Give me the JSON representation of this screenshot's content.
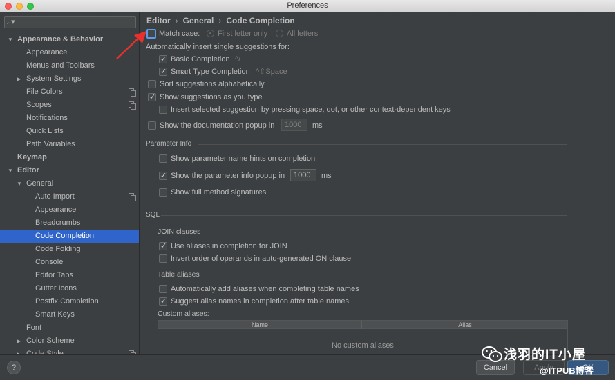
{
  "window": {
    "title": "Preferences"
  },
  "search": {
    "placeholder": ""
  },
  "sidebar": {
    "items": [
      {
        "label": "Appearance & Behavior",
        "level": 0,
        "arrow": "expanded",
        "bold": true,
        "selected": false,
        "settings_icon": false
      },
      {
        "label": "Appearance",
        "level": 1,
        "arrow": "none",
        "bold": false,
        "selected": false,
        "settings_icon": false
      },
      {
        "label": "Menus and Toolbars",
        "level": 1,
        "arrow": "none",
        "bold": false,
        "selected": false,
        "settings_icon": false
      },
      {
        "label": "System Settings",
        "level": 1,
        "arrow": "collapsed",
        "bold": false,
        "selected": false,
        "settings_icon": false
      },
      {
        "label": "File Colors",
        "level": 1,
        "arrow": "none",
        "bold": false,
        "selected": false,
        "settings_icon": true
      },
      {
        "label": "Scopes",
        "level": 1,
        "arrow": "none",
        "bold": false,
        "selected": false,
        "settings_icon": true
      },
      {
        "label": "Notifications",
        "level": 1,
        "arrow": "none",
        "bold": false,
        "selected": false,
        "settings_icon": false
      },
      {
        "label": "Quick Lists",
        "level": 1,
        "arrow": "none",
        "bold": false,
        "selected": false,
        "settings_icon": false
      },
      {
        "label": "Path Variables",
        "level": 1,
        "arrow": "none",
        "bold": false,
        "selected": false,
        "settings_icon": false
      },
      {
        "label": "Keymap",
        "level": 0,
        "arrow": "none",
        "bold": true,
        "selected": false,
        "settings_icon": false
      },
      {
        "label": "Editor",
        "level": 0,
        "arrow": "expanded",
        "bold": true,
        "selected": false,
        "settings_icon": false
      },
      {
        "label": "General",
        "level": 1,
        "arrow": "expanded",
        "bold": false,
        "selected": false,
        "settings_icon": false
      },
      {
        "label": "Auto Import",
        "level": 2,
        "arrow": "none",
        "bold": false,
        "selected": false,
        "settings_icon": true
      },
      {
        "label": "Appearance",
        "level": 2,
        "arrow": "none",
        "bold": false,
        "selected": false,
        "settings_icon": false
      },
      {
        "label": "Breadcrumbs",
        "level": 2,
        "arrow": "none",
        "bold": false,
        "selected": false,
        "settings_icon": false
      },
      {
        "label": "Code Completion",
        "level": 2,
        "arrow": "none",
        "bold": false,
        "selected": true,
        "settings_icon": false
      },
      {
        "label": "Code Folding",
        "level": 2,
        "arrow": "none",
        "bold": false,
        "selected": false,
        "settings_icon": false
      },
      {
        "label": "Console",
        "level": 2,
        "arrow": "none",
        "bold": false,
        "selected": false,
        "settings_icon": false
      },
      {
        "label": "Editor Tabs",
        "level": 2,
        "arrow": "none",
        "bold": false,
        "selected": false,
        "settings_icon": false
      },
      {
        "label": "Gutter Icons",
        "level": 2,
        "arrow": "none",
        "bold": false,
        "selected": false,
        "settings_icon": false
      },
      {
        "label": "Postfix Completion",
        "level": 2,
        "arrow": "none",
        "bold": false,
        "selected": false,
        "settings_icon": false
      },
      {
        "label": "Smart Keys",
        "level": 2,
        "arrow": "none",
        "bold": false,
        "selected": false,
        "settings_icon": false
      },
      {
        "label": "Font",
        "level": 1,
        "arrow": "none",
        "bold": false,
        "selected": false,
        "settings_icon": false
      },
      {
        "label": "Color Scheme",
        "level": 1,
        "arrow": "collapsed",
        "bold": false,
        "selected": false,
        "settings_icon": false
      },
      {
        "label": "Code Style",
        "level": 1,
        "arrow": "collapsed",
        "bold": false,
        "selected": false,
        "settings_icon": true
      }
    ]
  },
  "breadcrumb": {
    "items": [
      "Editor",
      "General",
      "Code Completion"
    ],
    "separator": "›"
  },
  "completion": {
    "match_case": {
      "label": "Match case:",
      "checked": false,
      "options": [
        "First letter only",
        "All letters"
      ],
      "selected_option": "First letter only"
    },
    "auto_insert_heading": "Automatically insert single suggestions for:",
    "basic": {
      "label": "Basic Completion",
      "shortcut": "^/",
      "checked": true
    },
    "smart": {
      "label": "Smart Type Completion",
      "shortcut": "^⇧Space",
      "checked": true
    },
    "sort_alpha": {
      "label": "Sort suggestions alphabetically",
      "checked": false
    },
    "show_as_type": {
      "label": "Show suggestions as you type",
      "checked": true
    },
    "insert_selected": {
      "label": "Insert selected suggestion by pressing space, dot, or other context-dependent keys",
      "checked": false
    },
    "doc_popup": {
      "label": "Show the documentation popup in",
      "value": "1000",
      "unit": "ms",
      "checked": false
    }
  },
  "parameter_info": {
    "title": "Parameter Info",
    "name_hints": {
      "label": "Show parameter name hints on completion",
      "checked": false
    },
    "info_popup": {
      "label": "Show the parameter info popup in",
      "value": "1000",
      "unit": "ms",
      "checked": true
    },
    "full_signatures": {
      "label": "Show full method signatures",
      "checked": false
    }
  },
  "sql": {
    "title": "SQL",
    "join_title": "JOIN clauses",
    "use_aliases": {
      "label": "Use aliases in completion for JOIN",
      "checked": true
    },
    "invert_order": {
      "label": "Invert order of operands in auto-generated ON clause",
      "checked": false
    },
    "table_aliases_title": "Table aliases",
    "auto_add_aliases": {
      "label": "Automatically add aliases when completing table names",
      "checked": false
    },
    "suggest_alias_names": {
      "label": "Suggest alias names in completion after table names",
      "checked": true
    },
    "custom_aliases_label": "Custom aliases:",
    "table_columns": [
      "Name",
      "Alias"
    ],
    "table_empty": "No custom aliases"
  },
  "buttons": {
    "help": "?",
    "cancel": "Cancel",
    "apply": "Apply",
    "ok": "OK"
  },
  "watermark": {
    "text": "浅羽的IT小屋",
    "sub": "@ITPUB博客"
  },
  "colors": {
    "selection": "#2f65ca",
    "focus": "#5d9be7",
    "annotation_arrow": "#e8312d",
    "background": "#3c3f41"
  }
}
